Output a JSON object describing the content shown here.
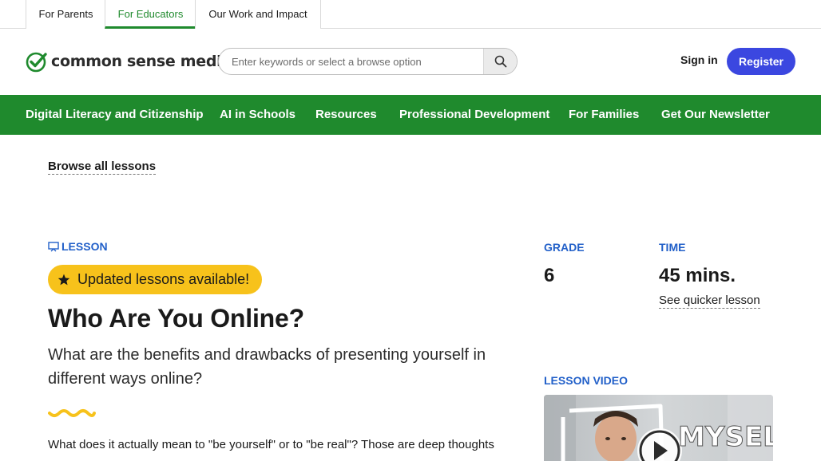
{
  "top_tabs": [
    {
      "label": "For Parents"
    },
    {
      "label": "For Educators"
    },
    {
      "label": "Our Work and Impact"
    }
  ],
  "header": {
    "logo_text": "common sense media",
    "search_placeholder": "Enter keywords or select a browse option",
    "search_icon": "search-icon",
    "sign_in": "Sign in",
    "register": "Register"
  },
  "nav": [
    {
      "label": "Digital Literacy and Citizenship"
    },
    {
      "label": "AI in Schools"
    },
    {
      "label": "Resources"
    },
    {
      "label": "Professional Development"
    },
    {
      "label": "For Families"
    },
    {
      "label": "Get Our Newsletter"
    }
  ],
  "breadcrumb": {
    "label": "Browse all lessons"
  },
  "lesson": {
    "type_label": "LESSON",
    "type_icon": "presentation-icon",
    "badge": "Updated lessons available!",
    "badge_icon": "star-icon",
    "title": "Who Are You Online?",
    "subtitle": "What are the benefits and drawbacks of presenting yourself in different ways online?",
    "intro": "What does it actually mean to \"be yourself\" or to \"be real\"? Those are deep thoughts"
  },
  "meta": {
    "grade_label": "GRADE",
    "grade_value": "6",
    "time_label": "TIME",
    "time_value": "45 mins.",
    "quicker_link": "See quicker lesson"
  },
  "video": {
    "label": "LESSON VIDEO",
    "thumbnail_text": "MYSELF",
    "play_icon": "play-icon"
  },
  "colors": {
    "brand_green": "#1f8a2d",
    "accent_blue": "#2260c9",
    "register_blue": "#3b47e0",
    "badge_yellow": "#f7c21b"
  }
}
